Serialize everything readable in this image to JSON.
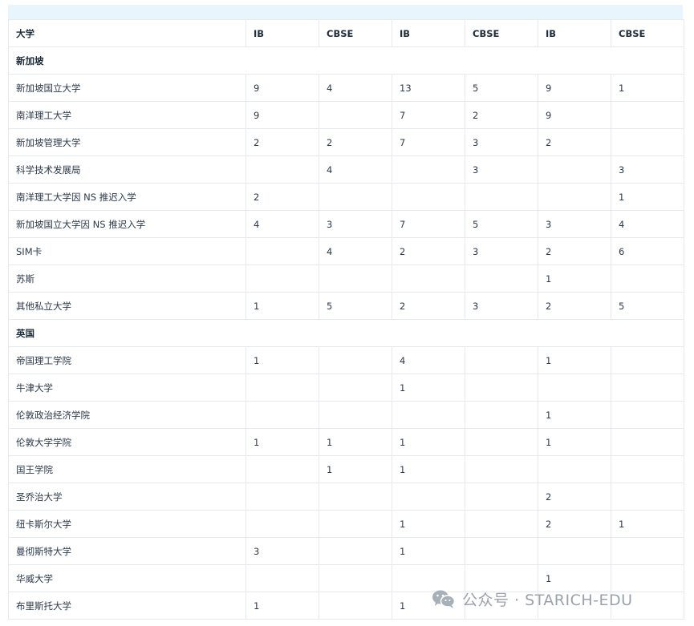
{
  "table": {
    "headers": [
      "大学",
      "IB",
      "CBSE",
      "IB",
      "CBSE",
      "IB",
      "CBSE"
    ],
    "rows": [
      {
        "section": "新加坡"
      },
      {
        "cells": [
          "新加坡国立大学",
          "9",
          "4",
          "13",
          "5",
          "9",
          "1"
        ]
      },
      {
        "cells": [
          "南洋理工大学",
          "9",
          "",
          "7",
          "2",
          "9",
          ""
        ]
      },
      {
        "cells": [
          "新加坡管理大学",
          "2",
          "2",
          "7",
          "3",
          "2",
          ""
        ]
      },
      {
        "cells": [
          "科学技术发展局",
          "",
          "4",
          "",
          "3",
          "",
          "3"
        ]
      },
      {
        "cells": [
          "南洋理工大学因 NS 推迟入学",
          "2",
          "",
          "",
          "",
          "",
          "1"
        ]
      },
      {
        "cells": [
          "新加坡国立大学因 NS 推迟入学",
          "4",
          "3",
          "7",
          "5",
          "3",
          "4"
        ]
      },
      {
        "cells": [
          "SIM卡",
          "",
          "4",
          "2",
          "3",
          "2",
          "6"
        ]
      },
      {
        "cells": [
          "苏斯",
          "",
          "",
          "",
          "",
          "1",
          ""
        ]
      },
      {
        "cells": [
          "其他私立大学",
          "1",
          "5",
          "2",
          "3",
          "2",
          "5"
        ]
      },
      {
        "section": "英国"
      },
      {
        "cells": [
          "帝国理工学院",
          "1",
          "",
          "4",
          "",
          "1",
          ""
        ]
      },
      {
        "cells": [
          "牛津大学",
          "",
          "",
          "1",
          "",
          "",
          ""
        ]
      },
      {
        "cells": [
          "伦敦政治经济学院",
          "",
          "",
          "",
          "",
          "1",
          ""
        ]
      },
      {
        "cells": [
          "伦敦大学学院",
          "1",
          "1",
          "1",
          "",
          "1",
          ""
        ]
      },
      {
        "cells": [
          "国王学院",
          "",
          "1",
          "1",
          "",
          "",
          ""
        ]
      },
      {
        "cells": [
          "圣乔治大学",
          "",
          "",
          "",
          "",
          "2",
          ""
        ]
      },
      {
        "cells": [
          "纽卡斯尔大学",
          "",
          "",
          "1",
          "",
          "2",
          "1"
        ]
      },
      {
        "cells": [
          "曼彻斯特大学",
          "3",
          "",
          "1",
          "",
          "",
          ""
        ]
      },
      {
        "cells": [
          "华威大学",
          "",
          "",
          "",
          "",
          "1",
          ""
        ]
      },
      {
        "cells": [
          "布里斯托大学",
          "1",
          "",
          "1",
          "",
          "",
          ""
        ]
      }
    ]
  },
  "watermark": {
    "text": "公众号 · STARICH-EDU",
    "icon": "wechat-icon",
    "color": "#9aa3ab"
  }
}
